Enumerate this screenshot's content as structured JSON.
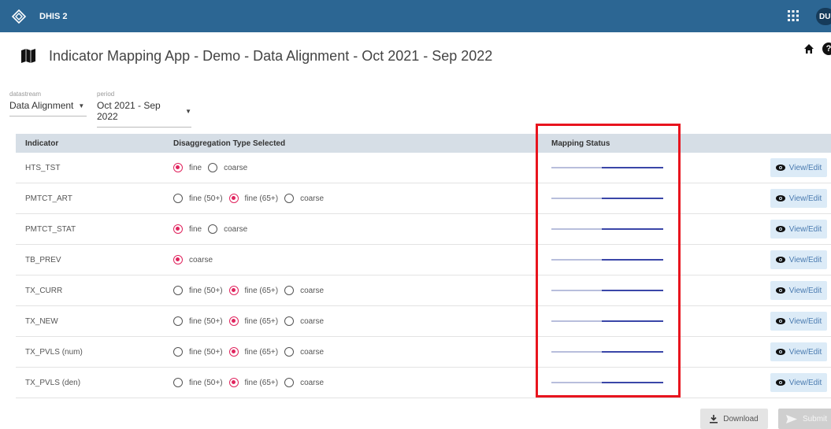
{
  "header": {
    "brand": "DHIS 2",
    "user_initials": "DU"
  },
  "page": {
    "title": "Indicator Mapping App - Demo - Data Alignment - Oct 2021 - Sep 2022"
  },
  "selectors": {
    "datastream": {
      "label": "datastream",
      "value": "Data Alignment"
    },
    "period": {
      "label": "period",
      "value": "Oct 2021 - Sep 2022"
    }
  },
  "table": {
    "headers": {
      "indicator": "Indicator",
      "disagg": "Disaggregation Type Selected",
      "status": "Mapping Status"
    },
    "view_label": "View/Edit",
    "rows": [
      {
        "indicator": "HTS_TST",
        "options": [
          {
            "label": "fine",
            "selected": true
          },
          {
            "label": "coarse",
            "selected": false
          }
        ]
      },
      {
        "indicator": "PMTCT_ART",
        "options": [
          {
            "label": "fine (50+)",
            "selected": false
          },
          {
            "label": "fine (65+)",
            "selected": true
          },
          {
            "label": "coarse",
            "selected": false
          }
        ]
      },
      {
        "indicator": "PMTCT_STAT",
        "options": [
          {
            "label": "fine",
            "selected": true
          },
          {
            "label": "coarse",
            "selected": false
          }
        ]
      },
      {
        "indicator": "TB_PREV",
        "options": [
          {
            "label": "coarse",
            "selected": true
          }
        ]
      },
      {
        "indicator": "TX_CURR",
        "options": [
          {
            "label": "fine (50+)",
            "selected": false
          },
          {
            "label": "fine (65+)",
            "selected": true
          },
          {
            "label": "coarse",
            "selected": false
          }
        ]
      },
      {
        "indicator": "TX_NEW",
        "options": [
          {
            "label": "fine (50+)",
            "selected": false
          },
          {
            "label": "fine (65+)",
            "selected": true
          },
          {
            "label": "coarse",
            "selected": false
          }
        ]
      },
      {
        "indicator": "TX_PVLS (num)",
        "options": [
          {
            "label": "fine (50+)",
            "selected": false
          },
          {
            "label": "fine (65+)",
            "selected": true
          },
          {
            "label": "coarse",
            "selected": false
          }
        ]
      },
      {
        "indicator": "TX_PVLS (den)",
        "options": [
          {
            "label": "fine (50+)",
            "selected": false
          },
          {
            "label": "fine (65+)",
            "selected": true
          },
          {
            "label": "coarse",
            "selected": false
          }
        ]
      }
    ]
  },
  "status_progress": {
    "fill_start": 0.45,
    "fill_end": 1.0
  },
  "footer": {
    "download_label": "Download",
    "submit_label": "Submit"
  },
  "colors": {
    "header_bg": "#2c6693",
    "accent_radio": "#e0245e",
    "highlight": "#e8141e",
    "status_fill": "#3a46a8",
    "status_track": "#b8bedc"
  }
}
